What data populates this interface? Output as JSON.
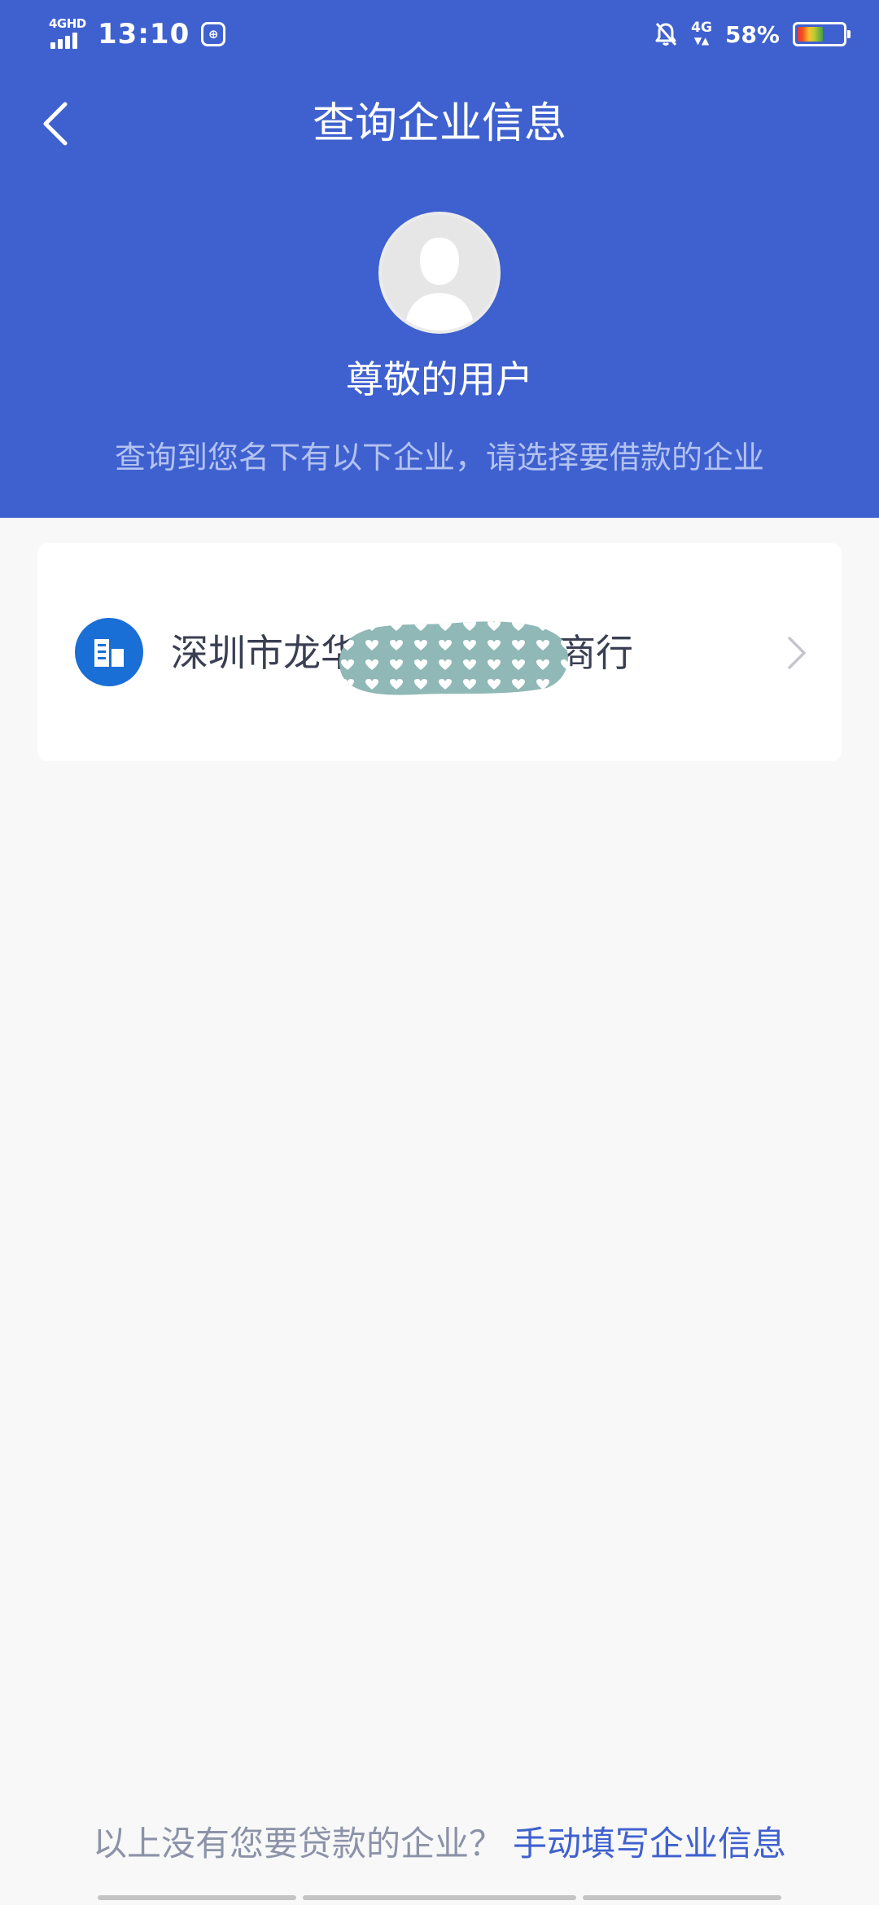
{
  "status_bar": {
    "network": "4GHD",
    "time": "13:10",
    "network_right": "4G",
    "battery": "58%",
    "battery_level": 0.58
  },
  "header": {
    "title": "查询企业信息",
    "user_name": "尊敬的用户",
    "subtitle": "查询到您名下有以下企业，请选择要借款的企业",
    "bg_color": "#3f61cf"
  },
  "companies": [
    {
      "name_prefix": "深圳市龙华",
      "name_suffix": "商行",
      "icon": "building-icon"
    }
  ],
  "footer": {
    "question": "以上没有您要贷款的企业？",
    "link": "手动填写企业信息"
  }
}
